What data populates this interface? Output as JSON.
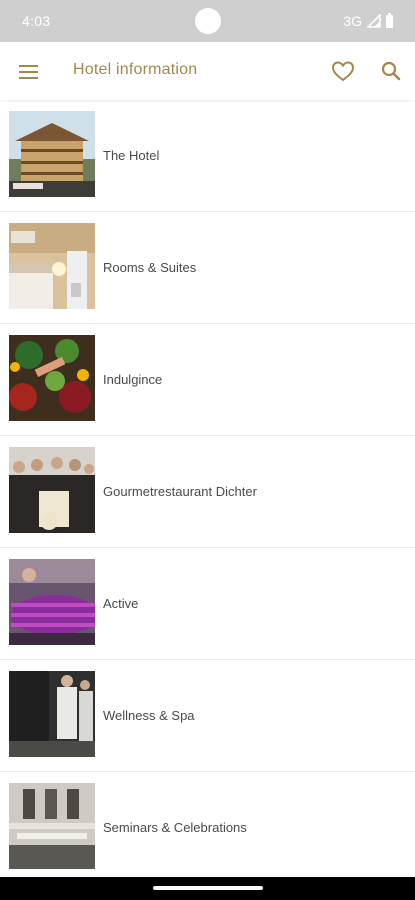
{
  "status_bar": {
    "time": "4:03",
    "network": "3G"
  },
  "app_bar": {
    "title": "Hotel information"
  },
  "colors": {
    "accent": "#a1894d",
    "status_bar": "#cfcfcf",
    "text": "#4a4a4a"
  },
  "icons": {
    "menu": "hamburger-menu-icon",
    "favorites": "heart-icon",
    "search": "search-icon"
  },
  "items": [
    {
      "label": "The Hotel"
    },
    {
      "label": "Rooms & Suites"
    },
    {
      "label": "Indulgince"
    },
    {
      "label": "Gourmetrestaurant Dichter"
    },
    {
      "label": "Active"
    },
    {
      "label": "Wellness & Spa"
    },
    {
      "label": "Seminars & Celebrations"
    }
  ]
}
